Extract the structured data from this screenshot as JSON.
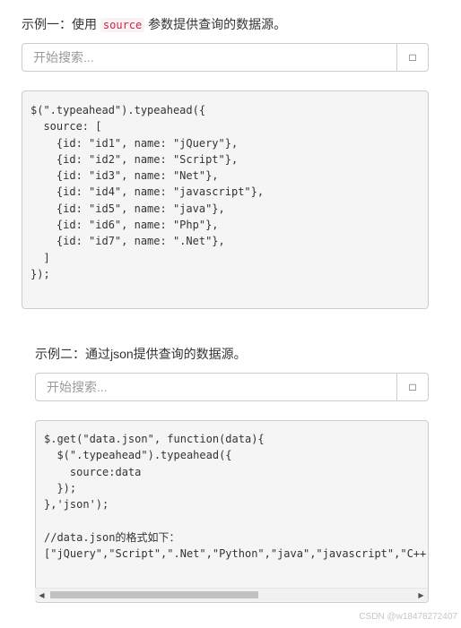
{
  "example1": {
    "heading_prefix": "示例一：使用",
    "heading_code": "source",
    "heading_suffix": "参数提供查询的数据源。",
    "search": {
      "placeholder": "开始搜索...",
      "button_icon": "search-icon"
    },
    "code": "$(\".typeahead\").typeahead({\n  source: [\n    {id: \"id1\", name: \"jQuery\"},\n    {id: \"id2\", name: \"Script\"},\n    {id: \"id3\", name: \"Net\"},\n    {id: \"id4\", name: \"javascript\"},\n    {id: \"id5\", name: \"java\"},\n    {id: \"id6\", name: \"Php\"},\n    {id: \"id7\", name: \".Net\"},\n  ]\n});"
  },
  "example2": {
    "heading": "示例二：通过json提供查询的数据源。",
    "search": {
      "placeholder": "开始搜索...",
      "button_icon": "search-icon"
    },
    "code": "$.get(\"data.json\", function(data){\n  $(\".typeahead\").typeahead({\n    source:data\n  });\n},'json');\n\n//data.json的格式如下：\n[\"jQuery\",\"Script\",\".Net\",\"Python\",\"java\",\"javascript\",\"C++\"",
    "scrollbar": {
      "left_arrow": "◀",
      "right_arrow": "▶"
    }
  },
  "watermark": "CSDN @w18478272407",
  "colors": {
    "inline_code": "#c7254e",
    "code_bg": "#f5f5f5",
    "border": "#cccccc"
  }
}
